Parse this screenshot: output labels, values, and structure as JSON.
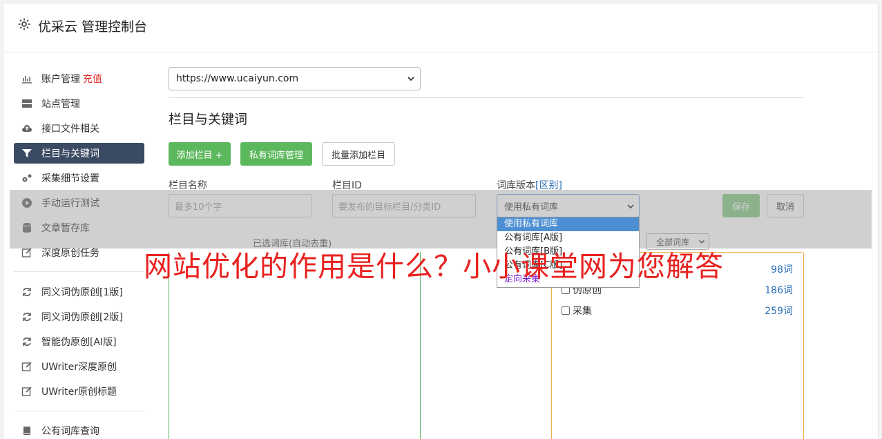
{
  "app": {
    "title": "优采云 管理控制台"
  },
  "sidebar": {
    "items": [
      {
        "label": "账户管理",
        "badge": "充值",
        "icon": "bar-chart-icon"
      },
      {
        "label": "站点管理",
        "icon": "server-icon"
      },
      {
        "label": "接口文件相关",
        "icon": "cloud-upload-icon"
      },
      {
        "label": "栏目与关键词",
        "icon": "filter-icon",
        "active": true
      },
      {
        "label": "采集细节设置",
        "icon": "gears-icon"
      },
      {
        "label": "手动运行测试",
        "icon": "play-circle-icon"
      },
      {
        "label": "文章暂存库",
        "icon": "database-icon"
      },
      {
        "label": "深度原创任务",
        "icon": "edit-icon"
      },
      {
        "label": "同义词伪原创[1版]",
        "icon": "refresh-icon"
      },
      {
        "label": "同义词伪原创[2版]",
        "icon": "refresh-icon"
      },
      {
        "label": "智能伪原创[AI版]",
        "icon": "refresh-icon"
      },
      {
        "label": "UWriter深度原创",
        "icon": "edit-icon"
      },
      {
        "label": "UWriter原创标题",
        "icon": "edit-icon"
      },
      {
        "label": "公有词库查询",
        "icon": "book-icon"
      }
    ]
  },
  "site_select": {
    "value": "https://www.ucaiyun.com"
  },
  "section": {
    "title": "栏目与关键词"
  },
  "toolbar": {
    "add_column": "添加栏目 +",
    "private_lib": "私有词库管理",
    "batch_add": "批量添加栏目"
  },
  "form": {
    "name_label": "栏目名称",
    "name_placeholder": "最多10个字",
    "id_label": "栏目ID",
    "id_placeholder": "要发布的目标栏目/分类ID",
    "version_label": "词库版本",
    "version_link": "[区别]",
    "version_value": "使用私有词库",
    "save": "保存",
    "cancel": "取消"
  },
  "version_options": [
    {
      "label": "使用私有词库",
      "selected": true
    },
    {
      "label": "公有词库[A版]"
    },
    {
      "label": "公有词库[B版]"
    },
    {
      "label": "公有词库[C版]"
    },
    {
      "label": "定向采集"
    }
  ],
  "selected_lib_title": "已选词库(自动去重)",
  "lib_filter": "全部词库",
  "libraries": [
    {
      "name": "",
      "count": "98词"
    },
    {
      "name": "伪原创",
      "count": "186词"
    },
    {
      "name": "采集",
      "count": "259词"
    }
  ],
  "watermark": "网站优化的作用是什么？小小课堂网为您解答",
  "colors": {
    "primary_green": "#5cb85c",
    "nav_active": "#3b4a63",
    "badge_red": "#e02b2b",
    "link_blue": "#2a6fb8",
    "watermark_red": "#e8211f"
  }
}
